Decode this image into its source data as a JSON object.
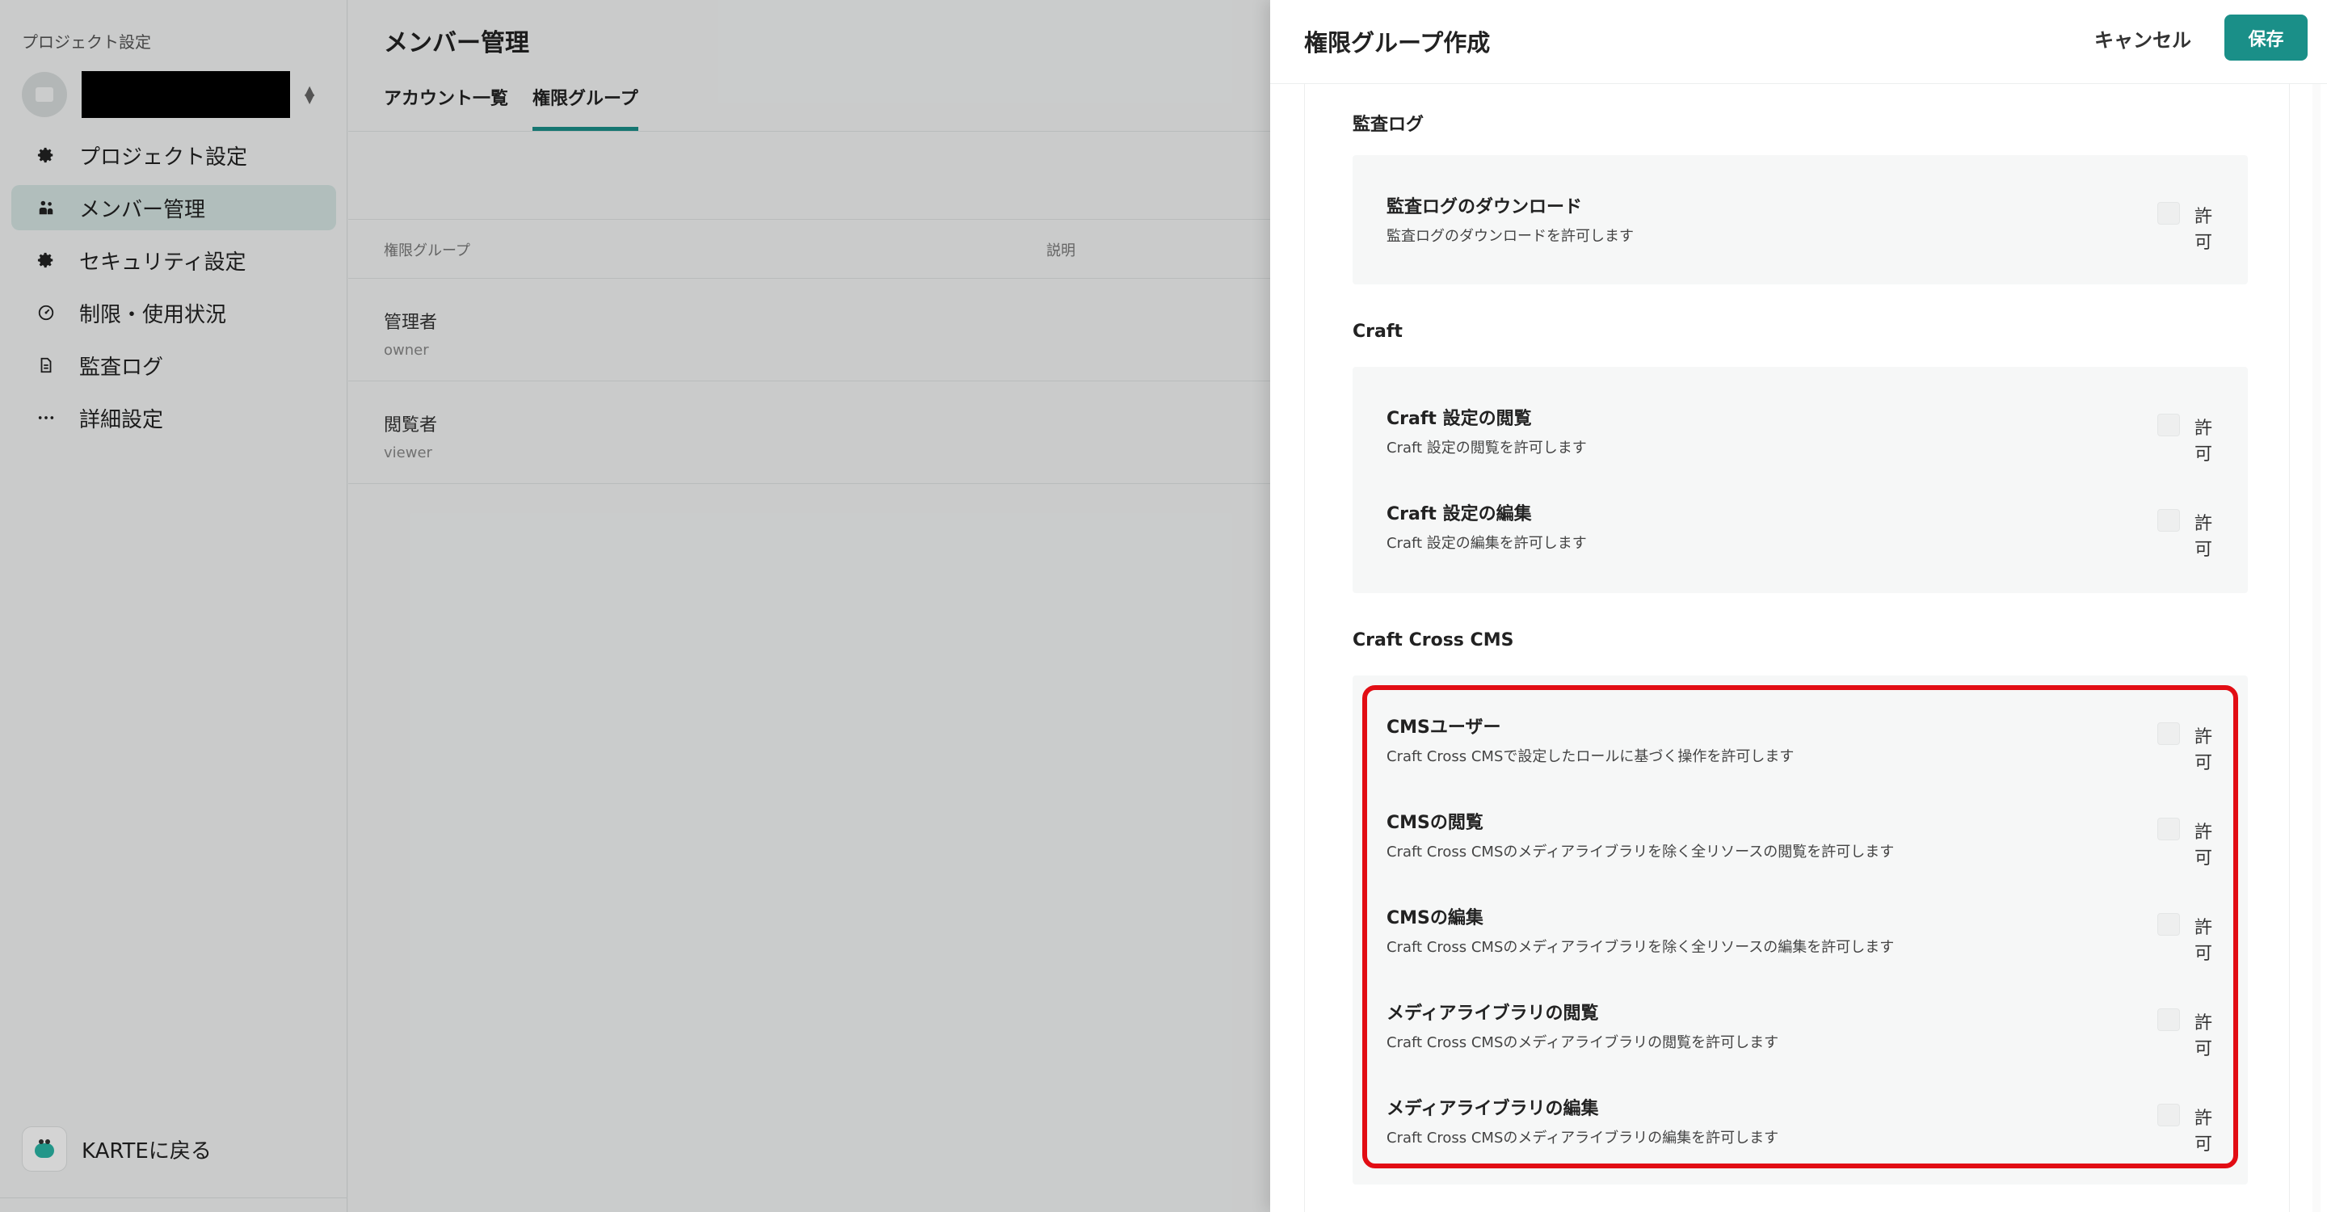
{
  "sidebar": {
    "section_label": "プロジェクト設定",
    "nav": [
      {
        "label": "プロジェクト設定",
        "icon": "gear-icon"
      },
      {
        "label": "メンバー管理",
        "icon": "members-icon"
      },
      {
        "label": "セキュリティ設定",
        "icon": "gear-icon"
      },
      {
        "label": "制限・使用状況",
        "icon": "gauge-icon"
      },
      {
        "label": "監査ログ",
        "icon": "document-icon"
      },
      {
        "label": "詳細設定",
        "icon": "more-icon"
      }
    ],
    "back_label": "KARTEに戻る"
  },
  "main": {
    "title": "メンバー管理",
    "tabs": [
      {
        "label": "アカウント一覧"
      },
      {
        "label": "権限グループ"
      }
    ],
    "table": {
      "headers": [
        "権限グループ",
        "説明"
      ],
      "rows": [
        {
          "name": "管理者",
          "key": "owner"
        },
        {
          "name": "閲覧者",
          "key": "viewer"
        }
      ]
    }
  },
  "panel": {
    "title": "権限グループ作成",
    "cancel_label": "キャンセル",
    "save_label": "保存",
    "sections": [
      {
        "title": "監査ログ",
        "permissions": [
          {
            "title": "監査ログのダウンロード",
            "desc": "監査ログのダウンロードを許可します",
            "check_label": "許可"
          }
        ]
      },
      {
        "title": "Craft",
        "permissions": [
          {
            "title": "Craft 設定の閲覧",
            "desc": "Craft 設定の閲覧を許可します",
            "check_label": "許可"
          },
          {
            "title": "Craft 設定の編集",
            "desc": "Craft 設定の編集を許可します",
            "check_label": "許可"
          }
        ]
      },
      {
        "title": "Craft Cross CMS",
        "permissions": [
          {
            "title": "CMSユーザー",
            "desc": "Craft Cross CMSで設定したロールに基づく操作を許可します",
            "check_label": "許可"
          },
          {
            "title": "CMSの閲覧",
            "desc": "Craft Cross CMSのメディアライブラリを除く全リソースの閲覧を許可します",
            "check_label": "許可"
          },
          {
            "title": "CMSの編集",
            "desc": "Craft Cross CMSのメディアライブラリを除く全リソースの編集を許可します",
            "check_label": "許可"
          },
          {
            "title": "メディアライブラリの閲覧",
            "desc": "Craft Cross CMSのメディアライブラリの閲覧を許可します",
            "check_label": "許可"
          },
          {
            "title": "メディアライブラリの編集",
            "desc": "Craft Cross CMSのメディアライブラリの編集を許可します",
            "check_label": "許可"
          }
        ]
      }
    ]
  },
  "colors": {
    "accent": "#1a8f88",
    "highlight": "#e20d14"
  }
}
